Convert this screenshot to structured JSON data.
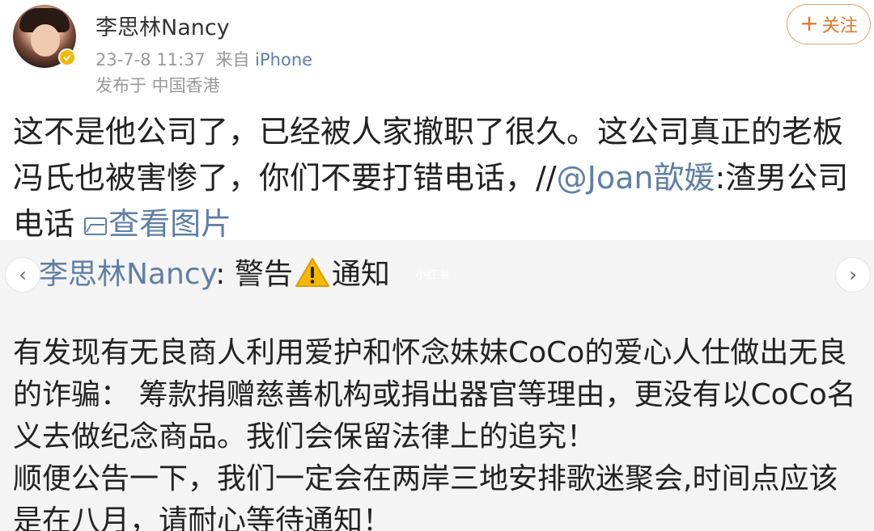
{
  "header": {
    "username": "李思林Nancy",
    "timestamp": "23-7-8 11:37",
    "source_prefix": "来自",
    "source": "iPhone",
    "location": "发布于 中国香港",
    "follow_plus": "+",
    "follow_label": "关注",
    "avatar_icon": "avatar",
    "verified_icon": "verified-badge-icon"
  },
  "post": {
    "text_main": "这不是他公司了，已经被人家撤职了很久。这公司真正的老板冯氏也被害惨了，你们不要打错电话，//",
    "mention": "@Joan歆媛",
    "text_after": ":渣男公司电话 ",
    "view_image": "查看图片",
    "view_image_icon": "image-icon"
  },
  "repost": {
    "author": "李思林Nancy",
    "title_mid": ": 警告",
    "title_end": "通知",
    "warning_icon": "warning-icon",
    "watermark": "小红书",
    "prev_icon": "chevron-left-icon",
    "next_icon": "chevron-right-icon",
    "prev_glyph": "‹",
    "next_glyph": "›",
    "lines": [
      "有发现有无良商人利用爱护和怀念妹妹CoCo的爱心人仕做出无良",
      "的诈骗： 筹款捐赠慈善机构或捐出器官等理由，更没有以CoCo名",
      "义去做纪念商品。我们会保留法律上的追究！",
      "顺便公告一下，我们一定会在两岸三地安排歌迷聚会,时间点应该",
      "是在八月，请耐心等待通知！"
    ]
  },
  "colors": {
    "link": "#5f7fa5",
    "follow": "#e0742b",
    "warning": "#f5b800",
    "repost_bg": "#f4f4f4"
  }
}
